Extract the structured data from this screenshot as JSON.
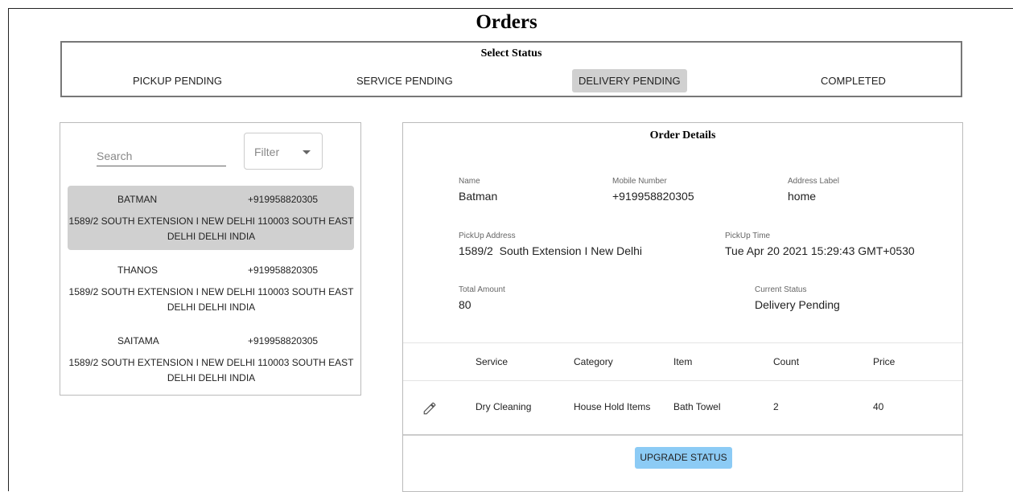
{
  "page": {
    "title": "Orders"
  },
  "status_selector": {
    "title": "Select Status",
    "options": [
      {
        "label": "PICKUP PENDING"
      },
      {
        "label": "SERVICE PENDING"
      },
      {
        "label": "DELIVERY PENDING"
      },
      {
        "label": "COMPLETED"
      }
    ],
    "selected": "DELIVERY PENDING"
  },
  "search": {
    "placeholder": "Search",
    "value": ""
  },
  "filter": {
    "label": "Filter"
  },
  "orders": [
    {
      "name": "BATMAN",
      "phone": "+919958820305",
      "address": "1589/2 SOUTH EXTENSION I NEW DELHI 110003 SOUTH EAST DELHI DELHI INDIA",
      "selected": true
    },
    {
      "name": "THANOS",
      "phone": "+919958820305",
      "address": "1589/2 SOUTH EXTENSION I NEW DELHI 110003 SOUTH EAST DELHI DELHI INDIA",
      "selected": false
    },
    {
      "name": "SAITAMA",
      "phone": "+919958820305",
      "address": "1589/2 SOUTH EXTENSION I NEW DELHI 110003 SOUTH EAST DELHI DELHI INDIA",
      "selected": false
    }
  ],
  "order_details": {
    "title": "Order Details",
    "name": {
      "label": "Name",
      "value": "Batman"
    },
    "mobile": {
      "label": "Mobile Number",
      "value": "+919958820305"
    },
    "address_label": {
      "label": "Address Label",
      "value": "home"
    },
    "pickup_address": {
      "label": "PickUp Address",
      "value": "1589/2  South Extension I New Delhi"
    },
    "pickup_time": {
      "label": "PickUp Time",
      "value": "Tue Apr 20 2021 15:29:43 GMT+0530"
    },
    "total_amount": {
      "label": "Total Amount",
      "value": "80"
    },
    "current_status": {
      "label": "Current Status",
      "value": "Delivery Pending"
    }
  },
  "items_table": {
    "headers": [
      "Service",
      "Category",
      "Item",
      "Count",
      "Price"
    ],
    "rows": [
      [
        "Dry Cleaning",
        "House Hold Items",
        "Bath Towel",
        "2",
        "40"
      ]
    ]
  },
  "actions": {
    "upgrade_label": "UPGRADE STATUS"
  },
  "icons": {
    "edit": "pencil-icon",
    "filter_caret": "caret-down-icon"
  },
  "colors": {
    "selected_bg": "#d0d0d0",
    "upgrade_button": "#8ccbf5"
  }
}
